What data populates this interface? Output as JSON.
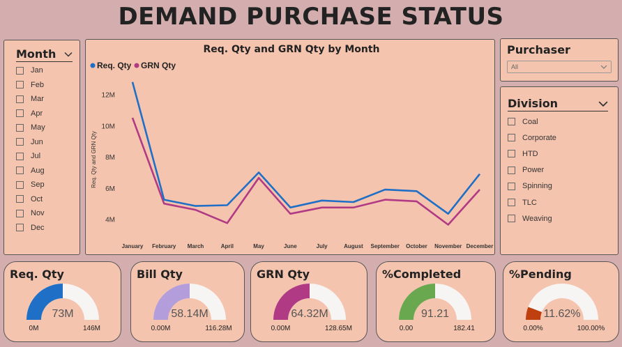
{
  "page": {
    "title": "DEMAND PURCHASE STATUS"
  },
  "month_slicer": {
    "title": "Month",
    "items": [
      "Jan",
      "Feb",
      "Mar",
      "Apr",
      "May",
      "Jun",
      "Jul",
      "Aug",
      "Sep",
      "Oct",
      "Nov",
      "Dec"
    ]
  },
  "purchaser_slicer": {
    "title": "Purchaser",
    "selected": "All"
  },
  "division_slicer": {
    "title": "Division",
    "items": [
      "Coal",
      "Corporate",
      "HTD",
      "Power",
      "Spinning",
      "TLC",
      "Weaving"
    ]
  },
  "chart_data": {
    "type": "line",
    "title": "Req. Qty and GRN Qty by Month",
    "ylabel": "Req. Qty and GRN Qty",
    "xlabel": "",
    "categories": [
      "January",
      "February",
      "March",
      "April",
      "May",
      "June",
      "July",
      "August",
      "September",
      "October",
      "November",
      "December"
    ],
    "series": [
      {
        "name": "Req. Qty",
        "color": "#1f6fc7",
        "values": [
          12.8,
          5.25,
          4.85,
          4.9,
          7.0,
          4.75,
          5.2,
          5.1,
          5.9,
          5.8,
          4.35,
          6.9
        ]
      },
      {
        "name": "GRN Qty",
        "color": "#b03a84",
        "values": [
          10.5,
          5.0,
          4.6,
          3.75,
          6.65,
          4.35,
          4.75,
          4.75,
          5.25,
          5.15,
          3.65,
          5.9
        ]
      }
    ],
    "yticks": [
      "4M",
      "6M",
      "8M",
      "10M",
      "12M"
    ],
    "ytick_values": [
      4,
      6,
      8,
      10,
      12
    ],
    "ylim": [
      3.0,
      13.5
    ],
    "legend": "top-left",
    "grid": false
  },
  "kpis": [
    {
      "title": "Req. Qty",
      "value": 73,
      "value_label": "73M",
      "min_label": "0M",
      "max": 146,
      "max_label": "146M",
      "color": "#1f6fc7"
    },
    {
      "title": "Bill Qty",
      "value": 58.14,
      "value_label": "58.14M",
      "min_label": "0.00M",
      "max": 116.28,
      "max_label": "116.28M",
      "color": "#b39ddb"
    },
    {
      "title": "GRN Qty",
      "value": 64.32,
      "value_label": "64.32M",
      "min_label": "0.00M",
      "max": 128.65,
      "max_label": "128.65M",
      "color": "#b03a84"
    },
    {
      "title": "%Completed",
      "value": 91.21,
      "value_label": "91.21",
      "min_label": "0.00",
      "max": 182.41,
      "max_label": "182.41",
      "color": "#6aa84f"
    },
    {
      "title": "%Pending",
      "value": 11.62,
      "value_label": "11.62%",
      "min_label": "0.00%",
      "max": 100,
      "max_label": "100.00%",
      "color": "#bf3f0f"
    }
  ]
}
